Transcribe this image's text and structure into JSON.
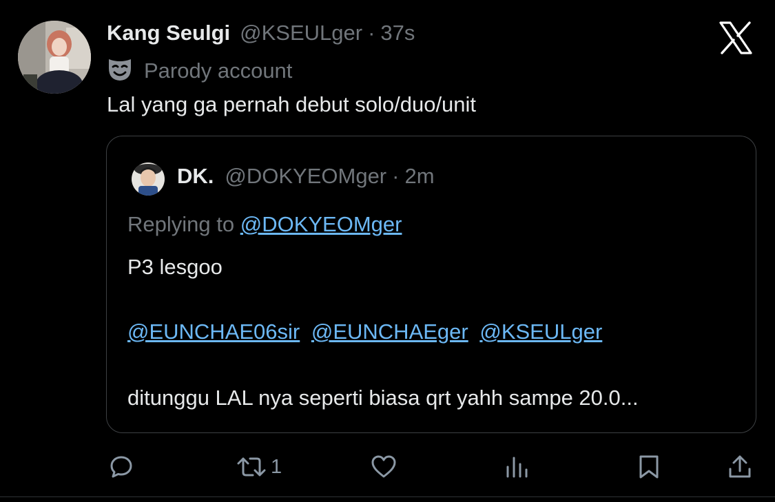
{
  "post": {
    "author": {
      "display_name": "Kang Seulgi",
      "handle": "@KSEULger",
      "separator": "·",
      "time": "37s",
      "label": "Parody account",
      "label_icon": "parody-mask-icon"
    },
    "text": "Lal yang ga pernah debut solo/duo/unit"
  },
  "quoted": {
    "display_name": "DK.",
    "handle": "@DOKYEOMger",
    "separator": "·",
    "time": "2m",
    "replying_prefix": "Replying to ",
    "replying_to": "@DOKYEOMger",
    "line1": "P3 lesgoo",
    "mentions": [
      "@EUNCHAE06sir",
      "@EUNCHAEger",
      "@KSEULger"
    ],
    "line3": "ditunggu LAL nya seperti biasa qrt yahh sampe 20.0..."
  },
  "actions": {
    "reply": {
      "icon": "reply-icon"
    },
    "repost": {
      "icon": "repost-icon",
      "count": "1"
    },
    "like": {
      "icon": "like-icon"
    },
    "views": {
      "icon": "views-icon"
    },
    "bookmark": {
      "icon": "bookmark-icon"
    },
    "share": {
      "icon": "share-icon"
    }
  },
  "brand": {
    "logo": "x-logo-icon"
  },
  "colors": {
    "background": "#000000",
    "text": "#e7e9ea",
    "secondary": "#71767b",
    "link": "#6cb8f5",
    "border": "#3e4144"
  }
}
